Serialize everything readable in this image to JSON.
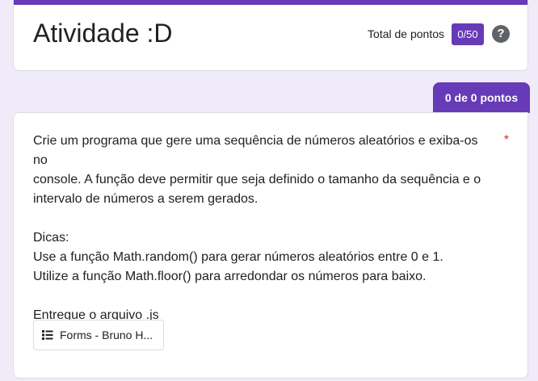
{
  "header": {
    "title": "Atividade :D",
    "points_label": "Total de pontos",
    "points_value": "0/50",
    "help_icon": "help-circle-icon"
  },
  "score_tab": {
    "label": "0 de 0 pontos"
  },
  "question": {
    "text": "Crie um programa que gere uma sequência de números aleatórios e exiba-os no\nconsole. A função deve permitir que seja definido o tamanho da sequência e o\nintervalo de números a serem gerados.\n\nDicas:\nUse a função Math.random() para gerar números aleatórios entre 0 e 1.\nUtilize a função Math.floor() para arredondar os números para baixo.\n\nEntregue o arquivo .js",
    "required_marker": "*",
    "attachment": {
      "icon": "list-icon",
      "label": "Forms - Bruno H..."
    }
  },
  "colors": {
    "accent": "#673ab7",
    "background": "#f0ebf8",
    "required": "#d93025"
  }
}
